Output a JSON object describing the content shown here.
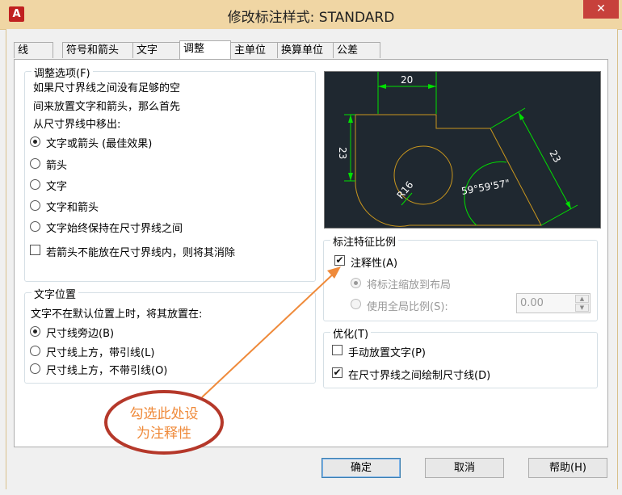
{
  "window": {
    "title": "修改标注样式: STANDARD",
    "app_icon": "A",
    "close": "✕"
  },
  "tabs": [
    {
      "label": "线"
    },
    {
      "label": "符号和箭头"
    },
    {
      "label": "文字"
    },
    {
      "label": "调整",
      "active": true
    },
    {
      "label": "主单位"
    },
    {
      "label": "换算单位"
    },
    {
      "label": "公差"
    }
  ],
  "fit": {
    "title": "调整选项(F)",
    "desc": [
      "如果尺寸界线之间没有足够的空",
      "间来放置文字和箭头，那么首先",
      "从尺寸界线中移出:"
    ],
    "options": [
      {
        "label": "文字或箭头 (最佳效果)",
        "checked": true
      },
      {
        "label": "箭头",
        "checked": false
      },
      {
        "label": "文字",
        "checked": false
      },
      {
        "label": "文字和箭头",
        "checked": false
      },
      {
        "label": "文字始终保持在尺寸界线之间",
        "checked": false
      }
    ],
    "suppress_label": "若箭头不能放在尺寸界线内，则将其消除",
    "suppress_checked": false
  },
  "text_placement": {
    "title": "文字位置",
    "desc": "文字不在默认位置上时，将其放置在:",
    "options": [
      {
        "label": "尺寸线旁边(B)",
        "checked": true
      },
      {
        "label": "尺寸线上方，带引线(L)",
        "checked": false
      },
      {
        "label": "尺寸线上方，不带引线(O)",
        "checked": false
      }
    ]
  },
  "preview": {
    "dim_top": "20",
    "dim_left": "23",
    "dim_right": "23",
    "dim_radius": "R16",
    "dim_angle": "59°59'57\""
  },
  "scale": {
    "title": "标注特征比例",
    "annotative_label": "注释性(A)",
    "annotative_checked": true,
    "layout_label": "将标注缩放到布局",
    "global_label": "使用全局比例(S):",
    "global_value": "0.00"
  },
  "finetune": {
    "title": "优化(T)",
    "manual_label": "手动放置文字(P)",
    "manual_checked": false,
    "draw_label": "在尺寸界线之间绘制尺寸线(D)",
    "draw_checked": true
  },
  "callout": {
    "line1": "勾选此处设",
    "line2": "为注释性",
    "color": "#ef8a3a",
    "ring_color": "#b5382a"
  },
  "buttons": {
    "ok": "确定",
    "cancel": "取消",
    "help": "帮助(H)"
  },
  "colors": {
    "preview_bg": "#1f2830",
    "dim_green": "#00e000",
    "geometry": "#c8961e"
  }
}
